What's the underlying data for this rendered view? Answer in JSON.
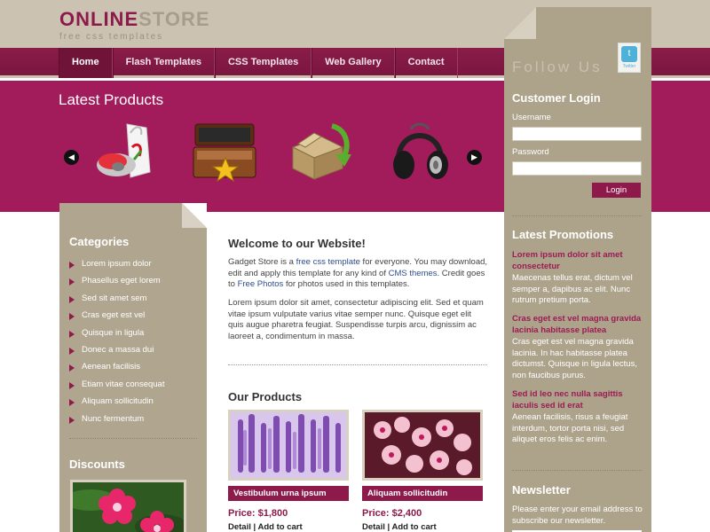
{
  "logo": {
    "part1": "ONLINE",
    "part2": "STORE",
    "tagline": "free css templates"
  },
  "nav": {
    "items": [
      "Home",
      "Flash Templates",
      "CSS Templates",
      "Web Gallery",
      "Contact"
    ],
    "active": "Home"
  },
  "hero": {
    "title": "Latest Products",
    "prev_icon": "arrow-left-icon",
    "next_icon": "arrow-right-icon"
  },
  "categories": {
    "title": "Categories",
    "items": [
      "Lorem ipsum dolor",
      "Phasellus eget lorem",
      "Sed sit amet sem",
      "Cras eget est vel",
      "Quisque in ligula",
      "Donec a massa dui",
      "Aenean facilisis",
      "Etiam vitae consequat",
      "Aliquam sollicitudin",
      "Nunc fermentum"
    ]
  },
  "discounts": {
    "title": "Discounts"
  },
  "welcome": {
    "title": "Welcome to our Website!",
    "p1_a": "Gadget Store is a ",
    "p1_link1": "free css template",
    "p1_b": " for everyone. You may download, edit and apply this template for any kind of ",
    "p1_link2": "CMS themes",
    "p1_c": ". Credit goes to ",
    "p1_link3": "Free Photos",
    "p1_d": " for photos used in this templates.",
    "p2": "Lorem ipsum dolor sit amet, consectetur adipiscing elit. Sed et quam vitae ipsum vulputate varius vitae semper nunc. Quisque eget elit quis augue pharetra feugiat. Suspendisse turpis arcu, dignissim ac laoreet a, condimentum in massa."
  },
  "products": {
    "title": "Our Products",
    "items": [
      {
        "name": "Vestibulum urna ipsum",
        "price": "Price: $1,800",
        "detail": "Detail",
        "sep": "|",
        "cart": "Add to cart"
      },
      {
        "name": "Aliquam sollicitudin",
        "price": "Price: $2,400",
        "detail": "Detail",
        "sep": "|",
        "cart": "Add to cart"
      }
    ]
  },
  "right": {
    "follow": "Follow Us",
    "twitter_label": "Twitter",
    "login_title": "Customer Login",
    "username_label": "Username",
    "password_label": "Password",
    "login_button": "Login",
    "promo_title": "Latest Promotions",
    "promos": [
      {
        "title": "Lorem ipsum dolor sit amet consectetur",
        "text": "Maecenas tellus erat, dictum vel semper a, dapibus ac elit. Nunc rutrum pretium porta."
      },
      {
        "title": "Cras eget est vel magna gravida lacinia habitasse platea",
        "text": "Cras eget est vel magna gravida lacinia. In hac habitasse platea dictumst. Quisque in ligula lectus, non faucibus purus."
      },
      {
        "title": "Sed id leo nec nulla sagittis iaculis sed id erat",
        "text": "Aenean facilisis, risus a feugiat interdum, tortor porta nisi, sed aliquet eros felis ac enim."
      }
    ],
    "newsletter_title": "Newsletter",
    "newsletter_text": "Please enter your email address to subscribe our newsletter."
  },
  "colors": {
    "brand": "#8e1a4c",
    "hero": "#a21b5a",
    "sidebar": "#b0a68f",
    "header": "#cbc2b1"
  }
}
